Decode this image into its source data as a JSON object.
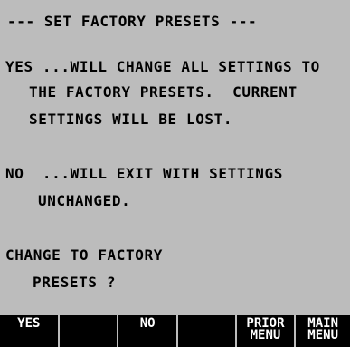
{
  "screen": {
    "title": "--- SET FACTORY PRESETS ---",
    "yes_text": [
      "YES ...WILL CHANGE ALL SETTINGS TO",
      "THE FACTORY PRESETS.  CURRENT",
      "SETTINGS WILL BE LOST."
    ],
    "no_text": [
      "NO  ...WILL EXIT WITH SETTINGS",
      "UNCHANGED."
    ],
    "question": [
      "CHANGE TO FACTORY",
      "PRESETS ?"
    ]
  },
  "softkeys": [
    {
      "line1": "YES",
      "line2": ""
    },
    {
      "line1": "",
      "line2": ""
    },
    {
      "line1": "NO",
      "line2": ""
    },
    {
      "line1": "",
      "line2": ""
    },
    {
      "line1": "PRIOR",
      "line2": "MENU"
    },
    {
      "line1": "MAIN",
      "line2": "MENU"
    }
  ]
}
